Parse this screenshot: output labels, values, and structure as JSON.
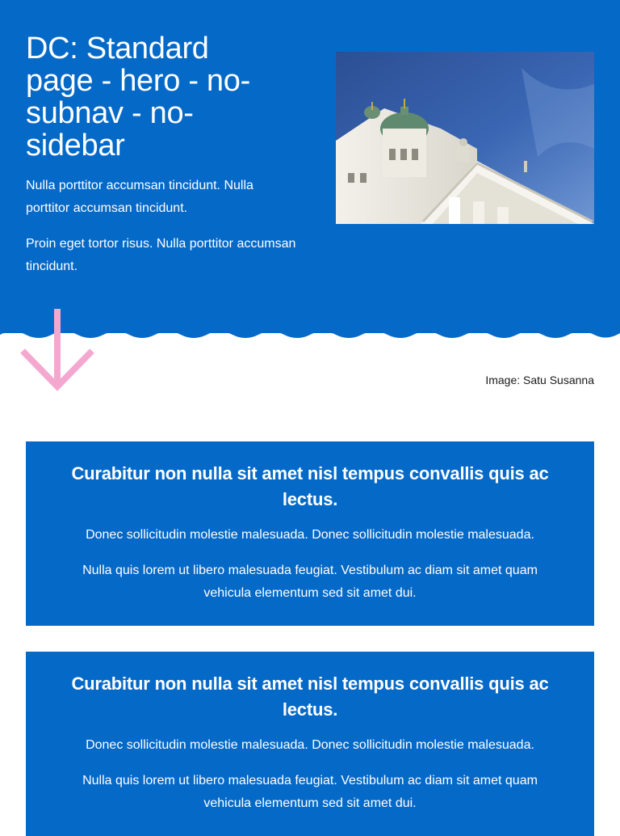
{
  "hero": {
    "title": "DC: Standard page - hero - no-subnav - no-sidebar",
    "paragraphs": [
      "Nulla porttitor accumsan tincidunt. Nulla porttitor accumsan tincidunt.",
      "Proin eget tortor risus. Nulla porttitor accumsan tincidunt."
    ],
    "image_subject": "helsinki-cathedral-photo",
    "image_caption": "Image: Satu Susanna"
  },
  "colors": {
    "brand_blue": "#0569c8",
    "arrow_pink": "#f5a8cf",
    "text_dark": "#1a1a1a"
  },
  "icons": {
    "scroll_arrow": "arrow-down-icon"
  },
  "cards": [
    {
      "title": "Curabitur non nulla sit amet nisl tempus convallis quis ac lectus.",
      "paragraphs": [
        "Donec sollicitudin molestie malesuada. Donec sollicitudin molestie malesuada.",
        "Nulla quis lorem ut libero malesuada feugiat. Vestibulum ac diam sit amet quam vehicula elementum sed sit amet dui."
      ]
    },
    {
      "title": "Curabitur non nulla sit amet nisl tempus convallis quis ac lectus.",
      "paragraphs": [
        "Donec sollicitudin molestie malesuada. Donec sollicitudin molestie malesuada.",
        "Nulla quis lorem ut libero malesuada feugiat. Vestibulum ac diam sit amet quam vehicula elementum sed sit amet dui."
      ]
    }
  ]
}
